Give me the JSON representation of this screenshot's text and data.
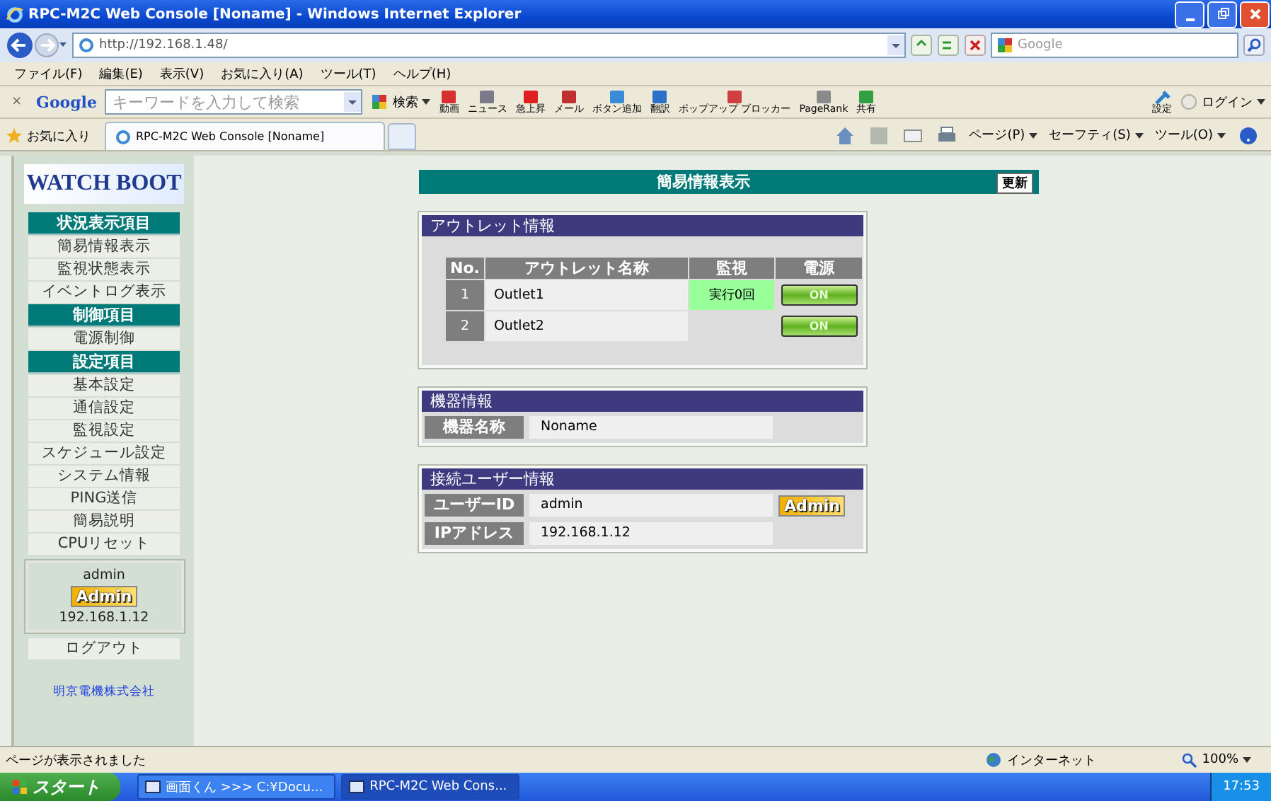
{
  "window": {
    "title": "RPC-M2C Web Console [Noname] - Windows Internet Explorer"
  },
  "address_bar": {
    "url": "http://192.168.1.48/",
    "search_placeholder": "Google"
  },
  "menu_bar": [
    "ファイル(F)",
    "編集(E)",
    "表示(V)",
    "お気に入り(A)",
    "ツール(T)",
    "ヘルプ(H)"
  ],
  "google_toolbar": {
    "close": "×",
    "logo": "Google",
    "placeholder": "キーワードを入力して検索",
    "search_button": "検索",
    "buttons": [
      "動画",
      "ニュース",
      "急上昇",
      "メール",
      "ボタン追加",
      "翻訳",
      "ポップアップ ブロッカー",
      "PageRank",
      "共有"
    ],
    "settings": "設定",
    "login": "ログイン"
  },
  "favorites_bar": {
    "favorites": "お気に入り",
    "tabs": [
      {
        "label": "RPC-M2C Web Console [Noname]",
        "selected": true
      }
    ],
    "commands": [
      "ページ(P)",
      "セーフティ(S)",
      "ツール(O)"
    ]
  },
  "sidebar": {
    "logo": "WATCH BOOT",
    "groups": [
      {
        "heading": "状況表示項目",
        "items": [
          "簡易情報表示",
          "監視状態表示",
          "イベントログ表示"
        ]
      },
      {
        "heading": "制御項目",
        "items": [
          "電源制御"
        ]
      },
      {
        "heading": "設定項目",
        "items": [
          "基本設定",
          "通信設定",
          "監視設定",
          "スケジュール設定",
          "システム情報",
          "PING送信",
          "簡易説明",
          "CPUリセット"
        ]
      }
    ],
    "user": {
      "name": "admin",
      "role": "Admin",
      "ip": "192.168.1.12"
    },
    "logout": "ログアウト",
    "company": "明京電機株式会社"
  },
  "page": {
    "title": "簡易情報表示",
    "refresh": "更新",
    "outlet_panel": {
      "title": "アウトレット情報",
      "columns": [
        "No.",
        "アウトレット名称",
        "監視",
        "電源"
      ],
      "rows": [
        {
          "no": "1",
          "name": "Outlet1",
          "monitor": "実行0回",
          "power": "ON"
        },
        {
          "no": "2",
          "name": "Outlet2",
          "power": "ON"
        }
      ]
    },
    "device_panel": {
      "title": "機器情報",
      "fields": [
        {
          "label": "機器名称",
          "value": "Noname"
        }
      ]
    },
    "user_panel": {
      "title": "接続ユーザー情報",
      "fields": [
        {
          "label": "ユーザーID",
          "value": "admin",
          "badge": "Admin"
        },
        {
          "label": "IPアドレス",
          "value": "192.168.1.12"
        }
      ]
    }
  },
  "status_bar": {
    "text": "ページが表示されました",
    "zone": "インターネット",
    "zoom": "100%"
  },
  "taskbar": {
    "start": "スタート",
    "tasks": [
      {
        "label": "画面くん >>> C:¥Docu...",
        "selected": false
      },
      {
        "label": "RPC-M2C Web Cons...",
        "selected": true
      }
    ],
    "clock": "17:53"
  }
}
